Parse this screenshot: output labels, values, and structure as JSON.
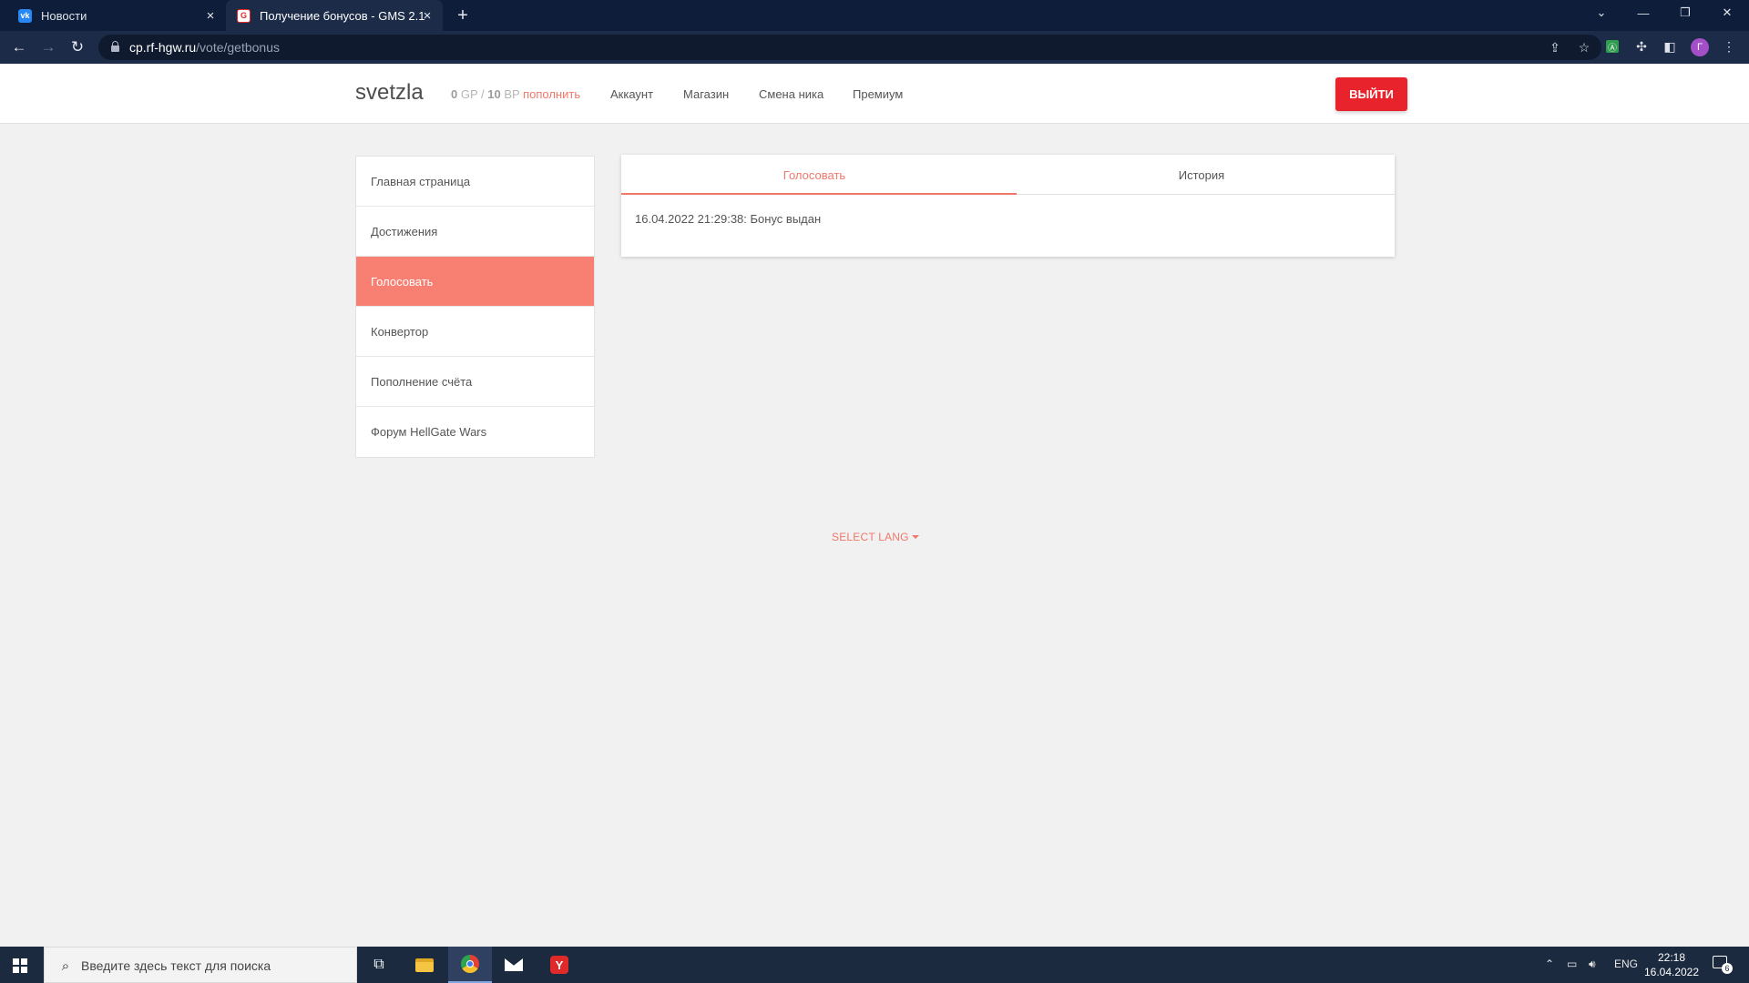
{
  "browser": {
    "tabs": [
      {
        "label": "Новости",
        "favicon": "vk-icon"
      },
      {
        "label": "Получение бонусов - GMS 2.1",
        "favicon": "gms-icon"
      }
    ],
    "url_host": "cp.rf-hgw.ru",
    "url_path": "/vote/getbonus",
    "profile_initial": "Г"
  },
  "header": {
    "username": "svetzla",
    "gp_value": "0",
    "gp_unit": "GP",
    "separator": "/",
    "bp_value": "10",
    "bp_unit": "BP",
    "topup_label": "пополнить",
    "menu": [
      "Аккаунт",
      "Магазин",
      "Смена ника",
      "Премиум"
    ],
    "logout_label": "ВЫЙТИ"
  },
  "sidebar": {
    "items": [
      {
        "label": "Главная страница",
        "active": false
      },
      {
        "label": "Достижения",
        "active": false
      },
      {
        "label": "Голосовать",
        "active": true
      },
      {
        "label": "Конвертор",
        "active": false
      },
      {
        "label": "Пополнение счёта",
        "active": false
      },
      {
        "label": "Форум HellGate Wars",
        "active": false
      }
    ]
  },
  "main": {
    "tabs": [
      {
        "label": "Голосовать",
        "active": true
      },
      {
        "label": "История",
        "active": false
      }
    ],
    "history_entry": "16.04.2022 21:29:38: Бонус выдан"
  },
  "footer": {
    "select_lang": "SELECT LANG"
  },
  "taskbar": {
    "search_placeholder": "Введите здесь текст для поиска",
    "language": "ENG",
    "time": "22:18",
    "date": "16.04.2022",
    "notification_count": "6"
  },
  "colors": {
    "accent": "#f0786a",
    "active_sidebar": "#f88073",
    "logout": "#e8232b",
    "browser_frame": "#0e1e3a"
  }
}
